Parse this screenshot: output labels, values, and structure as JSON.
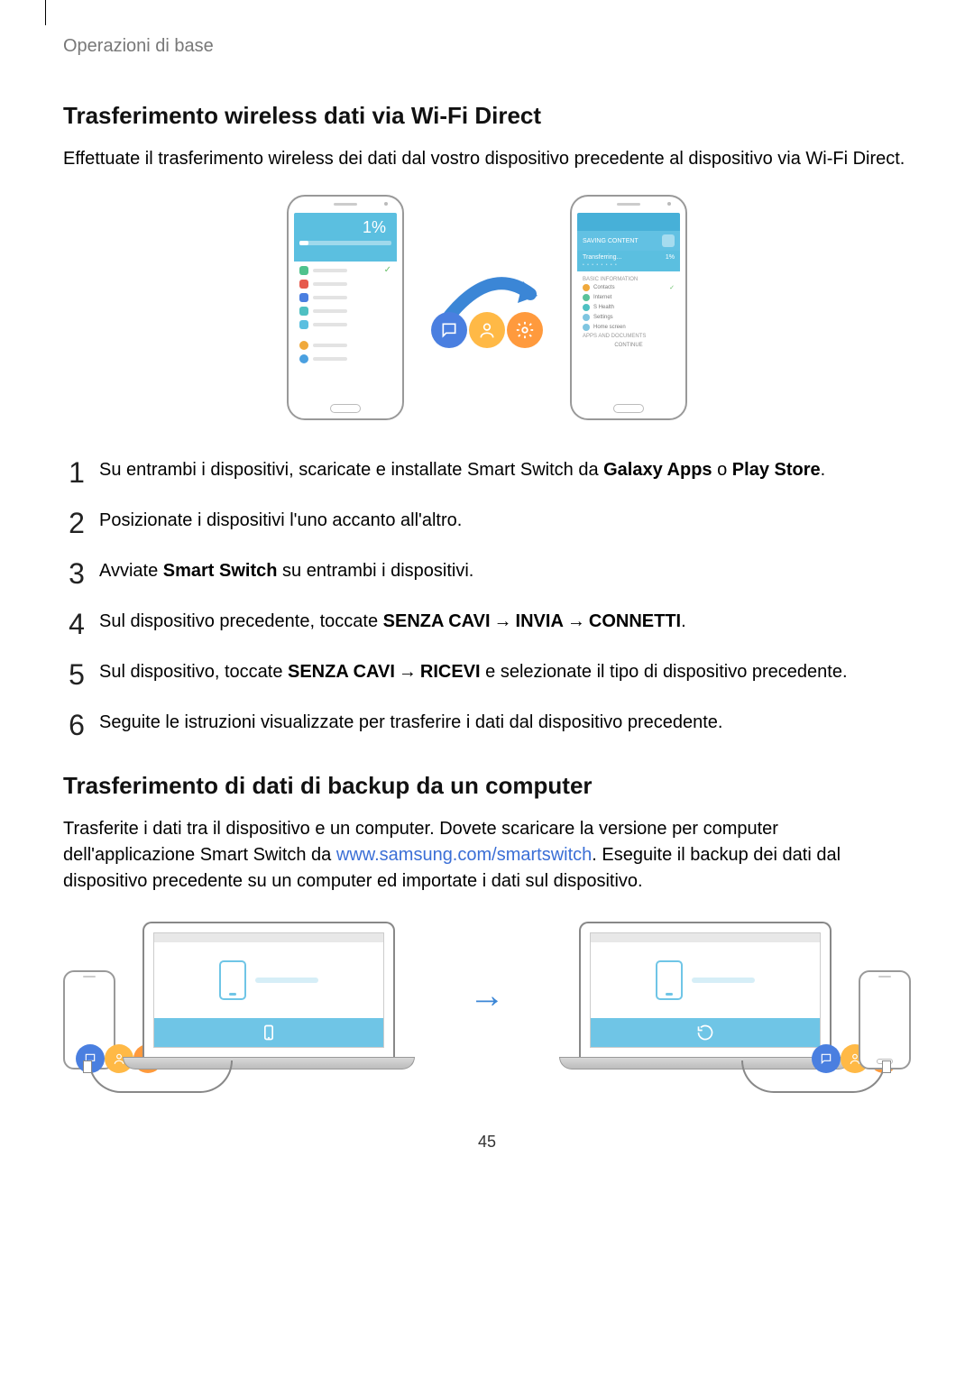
{
  "header": {
    "section": "Operazioni di base"
  },
  "wifi": {
    "title": "Trasferimento wireless dati via Wi-Fi Direct",
    "intro": "Effettuate il trasferimento wireless dei dati dal vostro dispositivo precedente al dispositivo via Wi-Fi Direct.",
    "left_percent": "1%",
    "right_transferring": "Transferring...",
    "right_percent": "1%",
    "right_basic_info": "BASIC INFORMATION",
    "right_contacts": "Contacts",
    "right_internet": "Internet",
    "right_shealth": "S Health",
    "right_settings": "Settings",
    "right_home": "Home screen",
    "right_apps_docs": "APPS AND DOCUMENTS",
    "right_continue": "CONTINUE"
  },
  "steps": {
    "s1_a": "Su entrambi i dispositivi, scaricate e installate Smart Switch da ",
    "s1_b": "Galaxy Apps",
    "s1_c": " o ",
    "s1_d": "Play Store",
    "s1_e": ".",
    "s2": "Posizionate i dispositivi l'uno accanto all'altro.",
    "s3_a": "Avviate ",
    "s3_b": "Smart Switch",
    "s3_c": " su entrambi i dispositivi.",
    "s4_a": "Sul dispositivo precedente, toccate ",
    "s4_b": "SENZA CAVI",
    "s4_c": "INVIA",
    "s4_d": "CONNETTI",
    "s4_e": ".",
    "s5_a": "Sul dispositivo, toccate ",
    "s5_b": "SENZA CAVI",
    "s5_c": "RICEVI",
    "s5_d": " e selezionate il tipo di dispositivo precedente.",
    "s6": "Seguite le istruzioni visualizzate per trasferire i dati dal dispositivo precedente."
  },
  "arrow": "→",
  "computer": {
    "title": "Trasferimento di dati di backup da un computer",
    "intro_a": "Trasferite i dati tra il dispositivo e un computer. Dovete scaricare la versione per computer dell'applicazione Smart Switch da ",
    "link_text": "www.samsung.com/smartswitch",
    "intro_b": ". Eseguite il backup dei dati dal dispositivo precedente su un computer ed importate i dati sul dispositivo."
  },
  "page_number": "45"
}
